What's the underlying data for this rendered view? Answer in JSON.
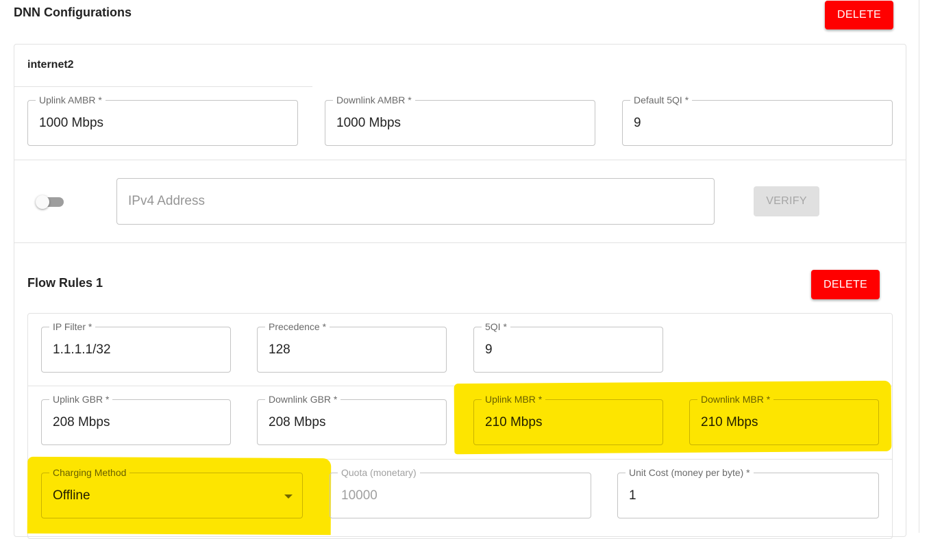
{
  "header": {
    "title": "DNN Configurations",
    "delete_label": "DELETE"
  },
  "dnn": {
    "name": "internet2",
    "uplink_ambr": {
      "label": "Uplink AMBR *",
      "value": "1000 Mbps"
    },
    "downlink_ambr": {
      "label": "Downlink AMBR *",
      "value": "1000 Mbps"
    },
    "default_5qi": {
      "label": "Default 5QI *",
      "value": "9"
    },
    "static_ip": {
      "toggle_on": false,
      "placeholder": "IPv4 Address",
      "verify_label": "VERIFY"
    }
  },
  "flow_rule": {
    "title": "Flow Rules 1",
    "delete_label": "DELETE",
    "ip_filter": {
      "label": "IP Filter *",
      "value": "1.1.1.1/32"
    },
    "precedence": {
      "label": "Precedence *",
      "value": "128"
    },
    "five_qi": {
      "label": "5QI *",
      "value": "9"
    },
    "uplink_gbr": {
      "label": "Uplink GBR *",
      "value": "208 Mbps"
    },
    "downlink_gbr": {
      "label": "Downlink GBR *",
      "value": "208 Mbps"
    },
    "uplink_mbr": {
      "label": "Uplink MBR *",
      "value": "210 Mbps"
    },
    "downlink_mbr": {
      "label": "Downlink MBR *",
      "value": "210 Mbps"
    },
    "charging_method": {
      "label": "Charging Method",
      "value": "Offline"
    },
    "quota": {
      "label": "Quota (monetary)",
      "value": "10000"
    },
    "unit_cost": {
      "label": "Unit Cost (money per byte) *",
      "value": "1"
    }
  },
  "colors": {
    "accent_red": "#ff0000",
    "highlight": "#fde500"
  },
  "icons": {
    "select_caret": "caret-down-icon"
  }
}
